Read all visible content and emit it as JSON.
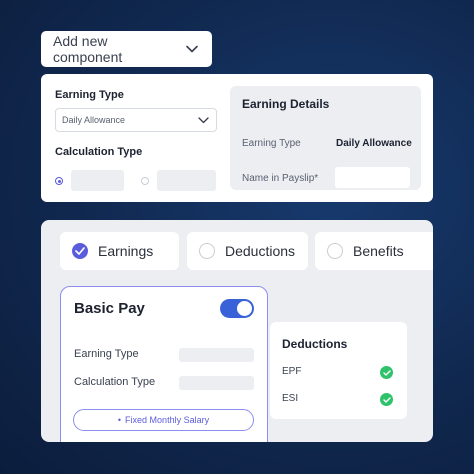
{
  "dropdown": {
    "label": "Add new component"
  },
  "earning_form": {
    "earning_type_label": "Earning Type",
    "earning_type_value": "Daily Allowance",
    "calculation_type_label": "Calculation Type"
  },
  "earning_details": {
    "title": "Earning Details",
    "earning_type_key": "Earning Type",
    "earning_type_value": "Daily Allowance",
    "name_in_payslip_key": "Name in Payslip*"
  },
  "tabs": [
    {
      "label": "Earnings",
      "selected": true
    },
    {
      "label": "Deductions",
      "selected": false
    },
    {
      "label": "Benefits",
      "selected": false
    }
  ],
  "basic_pay": {
    "title": "Basic Pay",
    "toggle_on": true,
    "earning_type_label": "Earning Type",
    "calculation_type_label": "Calculation Type",
    "button_label": "Fixed Monthly Salary",
    "button_bullet": "•"
  },
  "deductions_panel": {
    "title": "Deductions",
    "items": [
      {
        "label": "EPF",
        "checked": true
      },
      {
        "label": "ESI",
        "checked": true
      }
    ]
  },
  "colors": {
    "accent": "#5b5cdb",
    "toggle": "#3a62d8",
    "check": "#2ec26a",
    "background": "#10284f"
  }
}
